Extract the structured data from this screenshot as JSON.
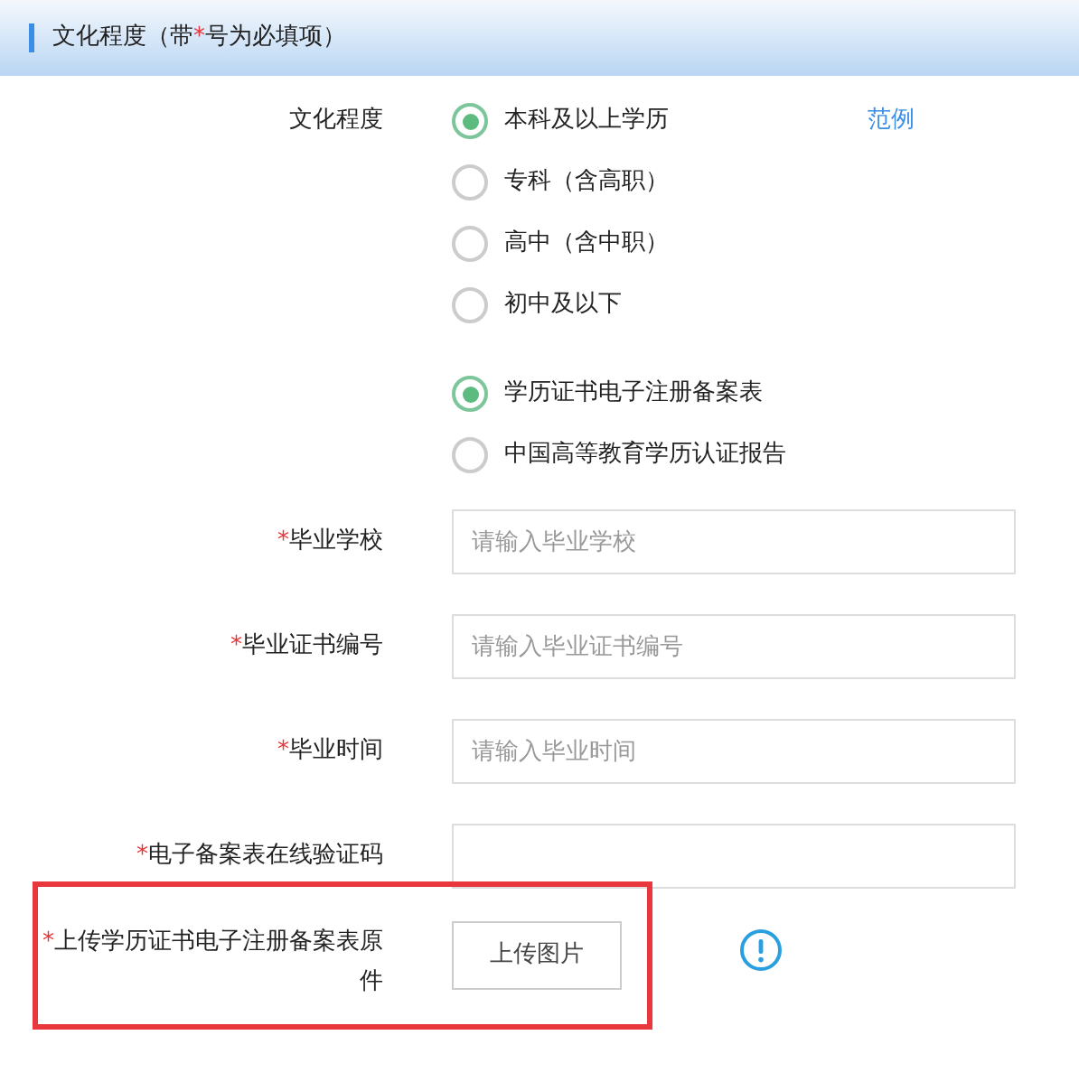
{
  "header": {
    "prefix": "文化程度（带",
    "mark": "*",
    "suffix": "号为必填项）"
  },
  "education": {
    "label": "文化程度",
    "example_link": "范例",
    "options": [
      {
        "label": "本科及以上学历",
        "selected": true
      },
      {
        "label": "专科（含高职）",
        "selected": false
      },
      {
        "label": "高中（含中职）",
        "selected": false
      },
      {
        "label": "初中及以下",
        "selected": false
      }
    ]
  },
  "certificate_type": {
    "options": [
      {
        "label": "学历证书电子注册备案表",
        "selected": true
      },
      {
        "label": "中国高等教育学历认证报告",
        "selected": false
      }
    ]
  },
  "fields": [
    {
      "mark": "*",
      "label": "毕业学校",
      "placeholder": "请输入毕业学校"
    },
    {
      "mark": "*",
      "label": "毕业证书编号",
      "placeholder": "请输入毕业证书编号"
    },
    {
      "mark": "*",
      "label": "毕业时间",
      "placeholder": "请输入毕业时间"
    },
    {
      "mark": "*",
      "label": "电子备案表在线验证码"
    }
  ],
  "upload": {
    "mark": "*",
    "label": "上传学历证书电子注册备案表原件",
    "button": "上传图片",
    "highlighted": true
  }
}
